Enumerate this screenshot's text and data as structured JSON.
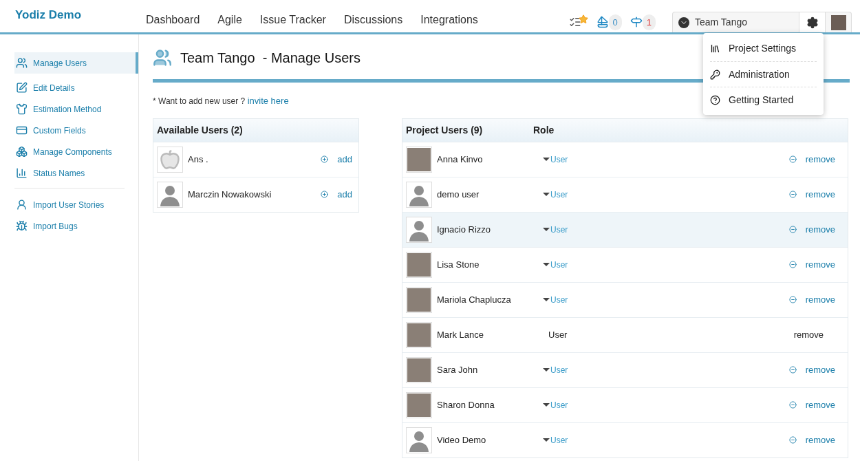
{
  "brand": "Yodiz Demo",
  "nav": [
    {
      "label": "Dashboard"
    },
    {
      "label": "Agile"
    },
    {
      "label": "Issue Tracker"
    },
    {
      "label": "Discussions"
    },
    {
      "label": "Integrations"
    }
  ],
  "header_counters": [
    {
      "kind": "releases",
      "count": "0"
    },
    {
      "kind": "alerts",
      "count": "1"
    }
  ],
  "project_selector": {
    "label": "Team Tango"
  },
  "settings_menu": {
    "expanded": true,
    "items": [
      {
        "kind": "settings",
        "label": "Project Settings"
      },
      {
        "kind": "admin",
        "label": "Administration"
      },
      {
        "kind": "help",
        "label": "Getting Started"
      }
    ]
  },
  "sidebar": {
    "groups": [
      [
        {
          "kind": "users",
          "label": "Manage Users",
          "selected": true
        },
        {
          "kind": "edit",
          "label": "Edit Details",
          "selected": false
        },
        {
          "kind": "shirt",
          "label": "Estimation Method",
          "selected": false
        },
        {
          "kind": "fields",
          "label": "Custom Fields",
          "selected": false
        },
        {
          "kind": "components",
          "label": "Manage Components",
          "selected": false
        },
        {
          "kind": "bars",
          "label": "Status Names",
          "selected": false
        }
      ],
      [
        {
          "kind": "import-user",
          "label": "Import User Stories",
          "selected": false
        },
        {
          "kind": "import-bug",
          "label": "Import Bugs",
          "selected": false
        }
      ]
    ]
  },
  "page": {
    "team": "Team Tango",
    "title": "- Manage Users",
    "invite_text": "* Want to add new user ?",
    "invite_link": "invite here"
  },
  "available_users": {
    "title": "Available Users (2)",
    "rows": [
      {
        "name": "Ans .",
        "kind": "logo",
        "action": "add"
      },
      {
        "name": "Marczin Nowakowski",
        "kind": "silhouette",
        "action": "add"
      }
    ]
  },
  "project_users": {
    "title": "Project Users (9)",
    "role_heading": "Role",
    "rows": [
      {
        "name": "Anna Kinvo",
        "kind": "photo",
        "role": "User",
        "action": "remove",
        "disabled": false,
        "highlighted": false
      },
      {
        "name": "demo user",
        "kind": "silhouette",
        "role": "User",
        "action": "remove",
        "disabled": false,
        "highlighted": false
      },
      {
        "name": "Ignacio Rizzo",
        "kind": "silhouette",
        "role": "User",
        "action": "remove",
        "disabled": false,
        "highlighted": true
      },
      {
        "name": "Lisa Stone",
        "kind": "photo",
        "role": "User",
        "action": "remove",
        "disabled": false,
        "highlighted": false
      },
      {
        "name": "Mariola Chaplucza",
        "kind": "photo",
        "role": "User",
        "action": "remove",
        "disabled": false,
        "highlighted": false
      },
      {
        "name": "Mark Lance",
        "kind": "photo",
        "role": "User",
        "action": "remove",
        "disabled": true,
        "highlighted": false
      },
      {
        "name": "Sara John",
        "kind": "photo",
        "role": "User",
        "action": "remove",
        "disabled": false,
        "highlighted": false
      },
      {
        "name": "Sharon Donna",
        "kind": "photo",
        "role": "User",
        "action": "remove",
        "disabled": false,
        "highlighted": false
      },
      {
        "name": "Video Demo",
        "kind": "silhouette",
        "role": "User",
        "action": "remove",
        "disabled": false,
        "highlighted": false
      }
    ]
  }
}
